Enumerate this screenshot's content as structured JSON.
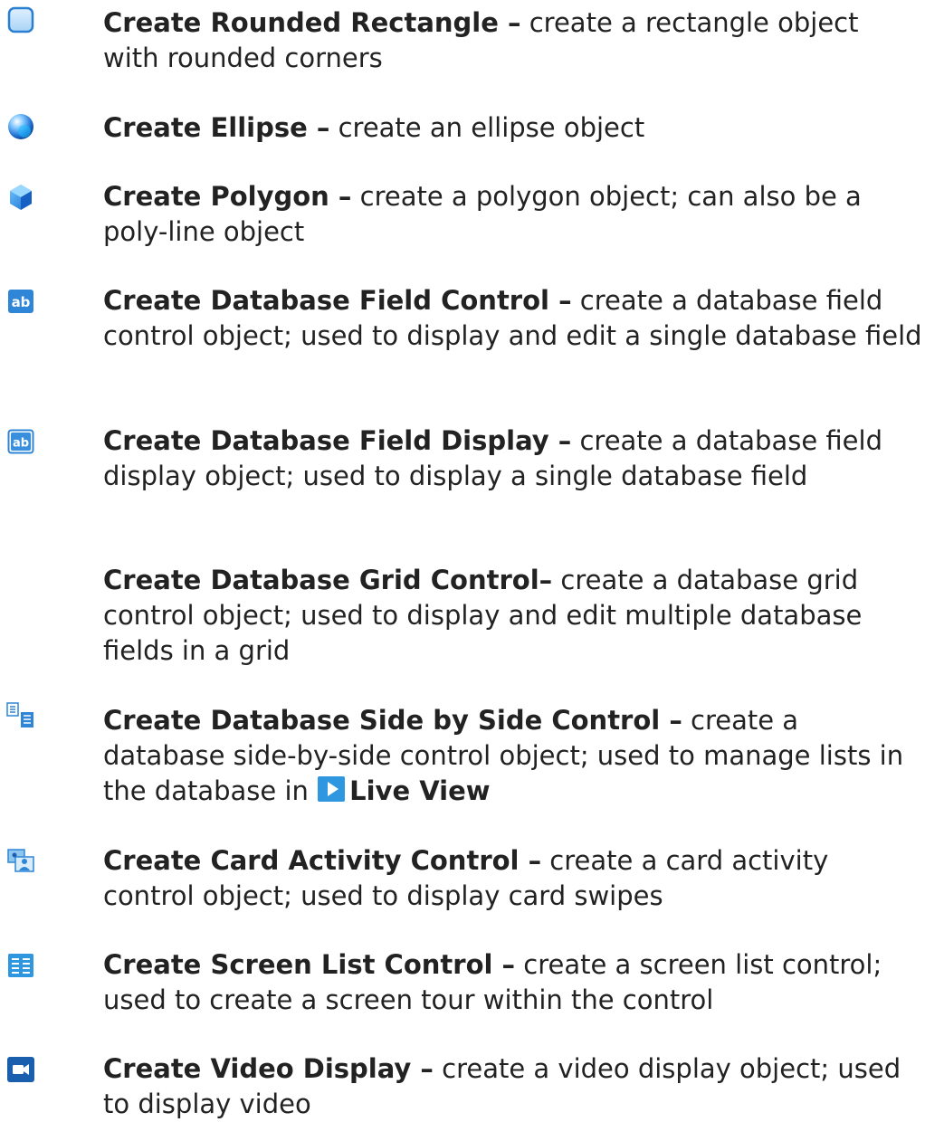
{
  "entries": [
    {
      "icon": "rounded-rectangle-icon",
      "title": "Create Rounded Rectangle –",
      "description": " create a rectangle object with rounded corners"
    },
    {
      "icon": "ellipse-icon",
      "title": "Create Ellipse –",
      "description": " create an ellipse object"
    },
    {
      "icon": "polygon-icon",
      "title": "Create Polygon –",
      "description": " create a polygon object; can also be a poly-line object"
    },
    {
      "icon": "database-field-control-icon",
      "icon_text": "ab",
      "title": "Create Database Field Control –",
      "description": " create a database field control object; used to display and edit a single database field"
    },
    {
      "icon": "database-field-display-icon",
      "icon_text": "ab",
      "title": "Create Database Field Display –",
      "description": " create a database field display object; used to display a single database field"
    },
    {
      "icon": "",
      "title": "Create Database Grid Control–",
      "description": " create a database grid control object; used to display and edit multiple database fields in a grid"
    },
    {
      "icon": "database-side-by-side-icon",
      "title": "Create Database Side by Side Control –",
      "description": " create a database side-by-side control object; used to manage lists in the database in ",
      "link_icon": "live-view-icon",
      "link_text": "Live View"
    },
    {
      "icon": "card-activity-icon",
      "title": "Create Card Activity Control –",
      "description": " create a card activity control object; used to display card swipes"
    },
    {
      "icon": "screen-list-icon",
      "title": "Create Screen List Control –",
      "description": " create a screen list control; used to create a screen tour within the control"
    },
    {
      "icon": "video-display-icon",
      "title": "Create Video Display –",
      "description": " create a video display object; used to display video"
    }
  ]
}
